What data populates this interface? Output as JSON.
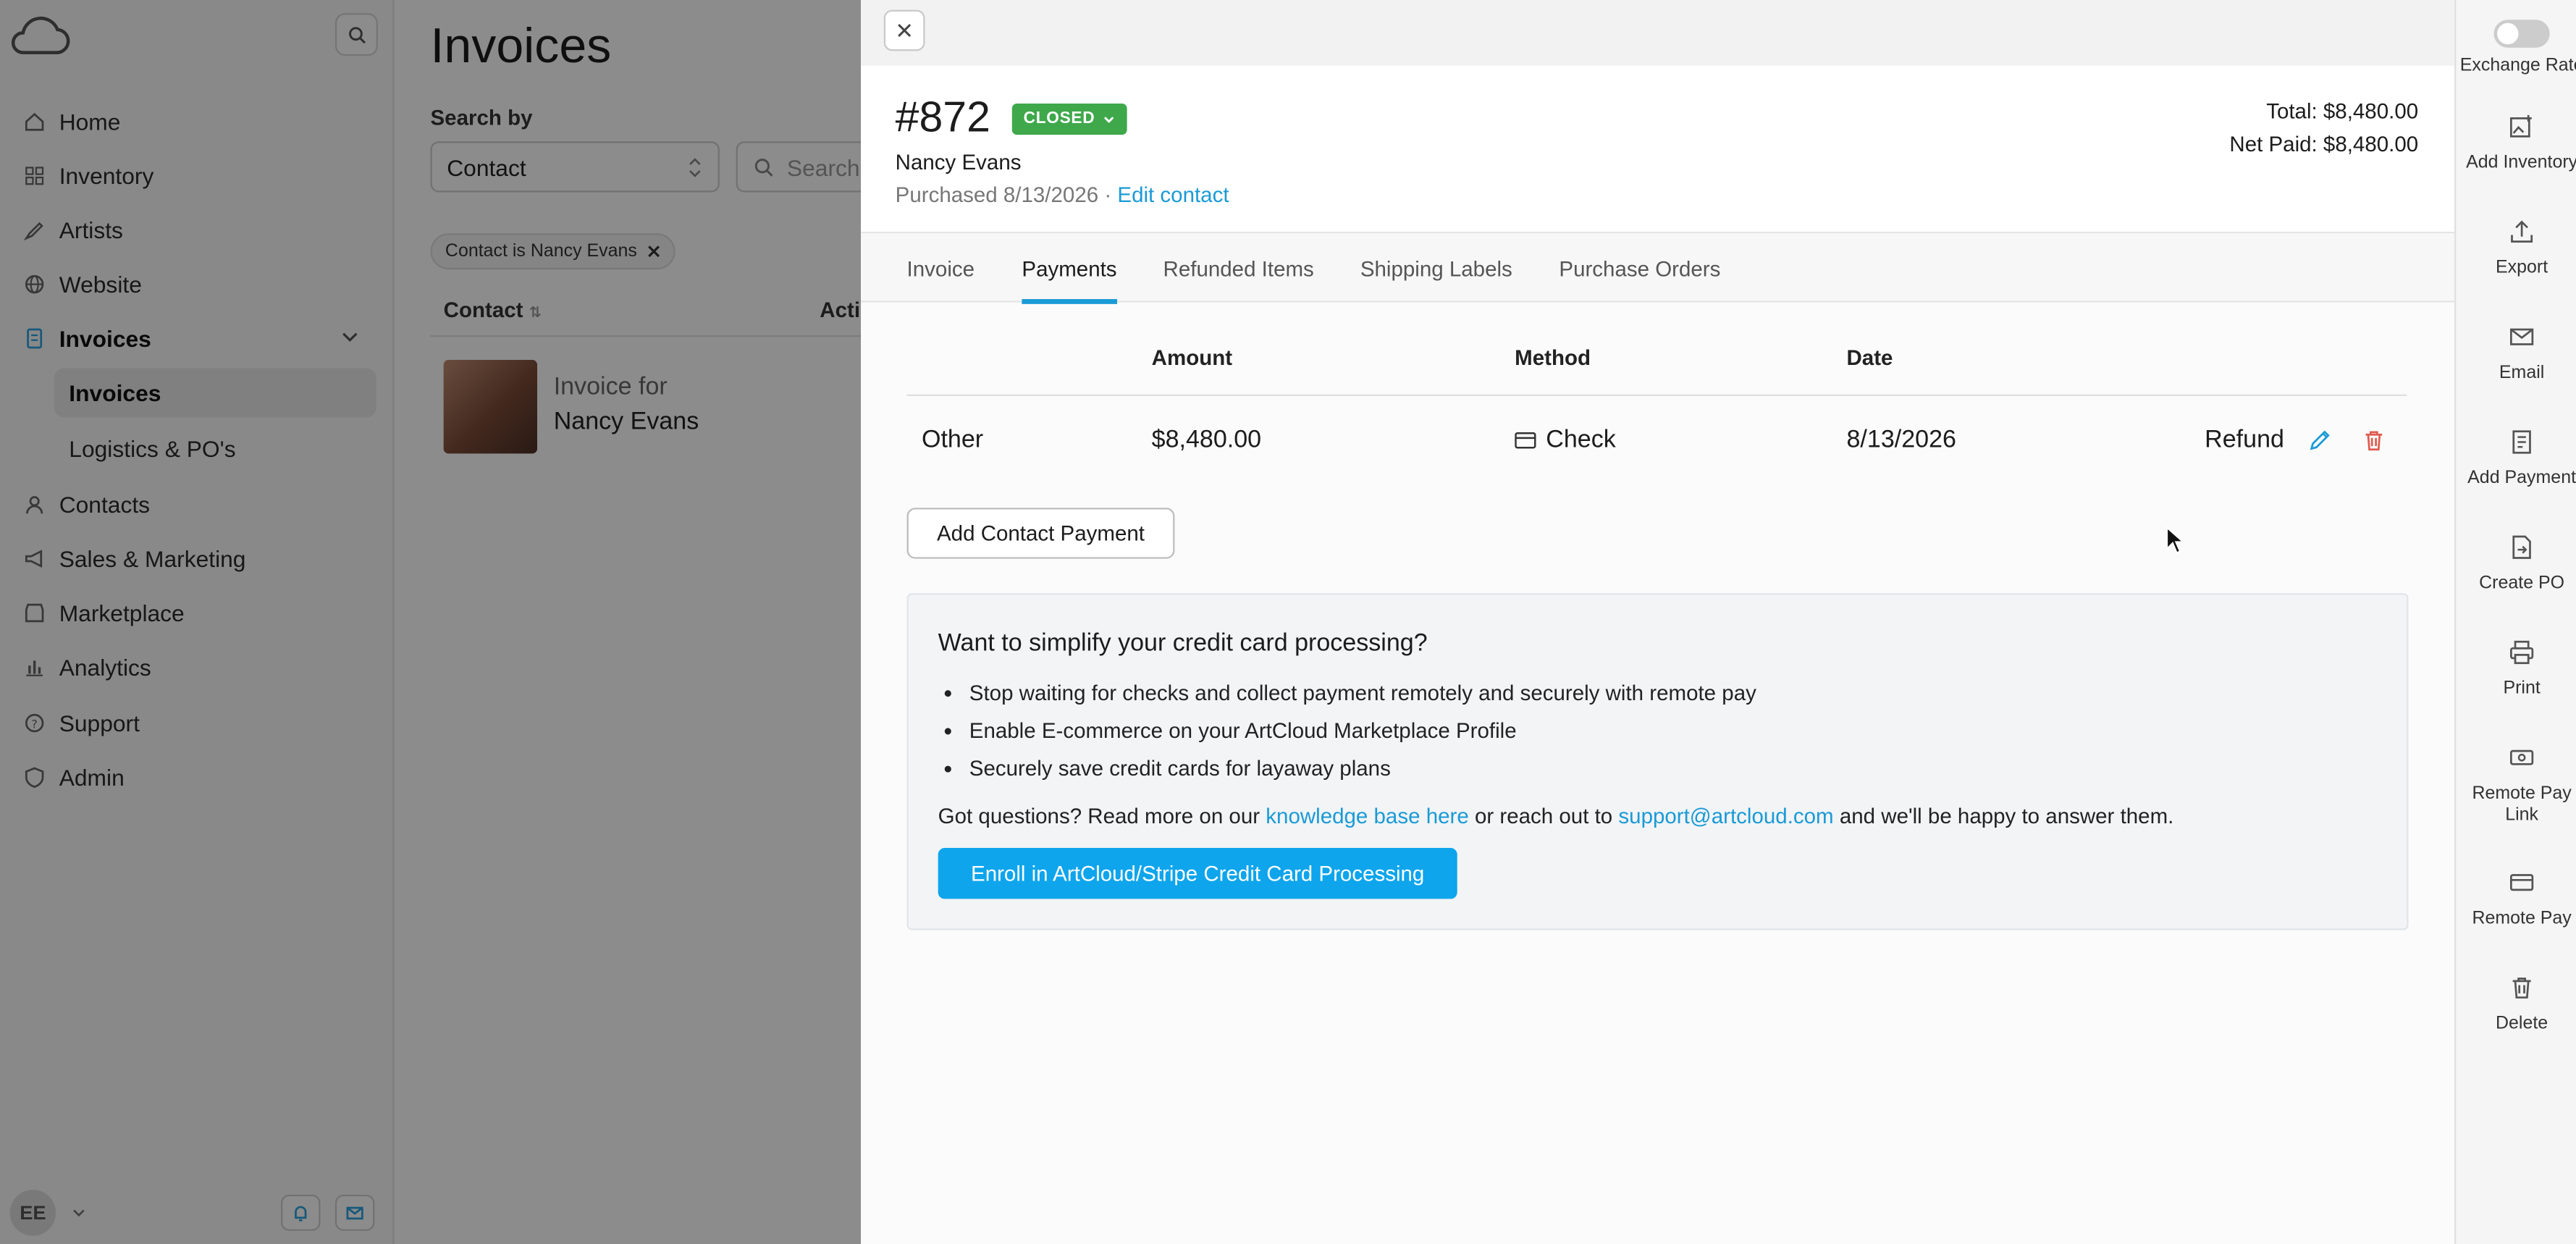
{
  "sidebar": {
    "nav": [
      "Home",
      "Inventory",
      "Artists",
      "Website",
      "Invoices",
      "Contacts",
      "Sales & Marketing",
      "Marketplace",
      "Analytics",
      "Support",
      "Admin"
    ],
    "sub": [
      "Invoices",
      "Logistics & PO's"
    ],
    "user_initials": "EE"
  },
  "main": {
    "title": "Invoices",
    "search_by_label": "Search by",
    "search_by_value": "Contact",
    "search_placeholder": "Search c",
    "filter_chip": "Contact is Nancy Evans",
    "col_contact": "Contact",
    "col_actions": "Actio",
    "row_line1": "Invoice for",
    "row_line2": "Nancy Evans"
  },
  "modal": {
    "invoice_number": "#872",
    "status": "CLOSED",
    "contact_name": "Nancy Evans",
    "purchased": "Purchased 8/13/2026 ·",
    "edit_contact": "Edit contact",
    "total": "Total: $8,480.00",
    "net_paid": "Net Paid: $8,480.00",
    "tabs": [
      "Invoice",
      "Payments",
      "Refunded Items",
      "Shipping Labels",
      "Purchase Orders"
    ],
    "payments": {
      "columns": [
        "Amount",
        "Method",
        "Date"
      ],
      "rows": [
        {
          "type": "Other",
          "amount": "$8,480.00",
          "method": "Check",
          "date": "8/13/2026",
          "action": "Refund"
        }
      ],
      "add_button": "Add Contact Payment"
    },
    "promo": {
      "title": "Want to simplify your credit card processing?",
      "bullets": [
        "Stop waiting for checks and collect payment remotely and securely with remote pay",
        "Enable E-commerce on your ArtCloud Marketplace Profile",
        "Securely save credit cards for layaway plans"
      ],
      "q_prefix": "Got questions? Read more on our",
      "kb_link": "knowledge base here",
      "q_mid": "or reach out to",
      "email_link": "support@artcloud.com",
      "q_suffix": "and we'll be happy to answer them.",
      "enroll_button": "Enroll in ArtCloud/Stripe Credit Card Processing"
    }
  },
  "rail": {
    "items": [
      "Exchange Rate",
      "Add Inventory",
      "Export",
      "Email",
      "Add Payment",
      "Create PO",
      "Print",
      "Remote Pay Link",
      "Remote Pay",
      "Delete"
    ]
  },
  "colors": {
    "accent": "#1a9ad6",
    "status_green": "#3ea84b",
    "enroll_blue": "#0ea5ec",
    "delete_red": "#e05a4f"
  }
}
